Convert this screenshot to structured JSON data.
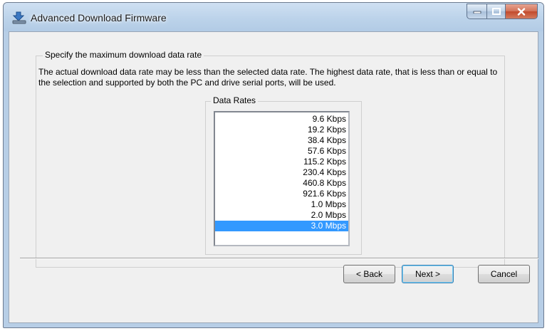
{
  "window": {
    "title": "Advanced Download Firmware",
    "icon": "download-firmware-app-icon",
    "controls": [
      "minimize-icon",
      "maximize-icon",
      "close-icon"
    ]
  },
  "group": {
    "legend": "Specify the maximum download data rate",
    "description": "The actual download data rate may be less than the selected data rate. The highest data rate, that is less than or equal to the selection and supported by both the PC and drive serial ports, will be used."
  },
  "rates": {
    "legend": "Data Rates",
    "items": [
      "9.6 Kbps",
      "19.2 Kbps",
      "38.4 Kbps",
      "57.6 Kbps",
      "115.2 Kbps",
      "230.4 Kbps",
      "460.8 Kbps",
      "921.6 Kbps",
      "1.0 Mbps",
      "2.0 Mbps",
      "3.0 Mbps"
    ],
    "selected": "3.0 Mbps"
  },
  "buttons": {
    "back": "< Back",
    "next": "Next >",
    "cancel": "Cancel"
  },
  "colors": {
    "selection": "#3399ff",
    "close_button": "#c24a2c"
  }
}
